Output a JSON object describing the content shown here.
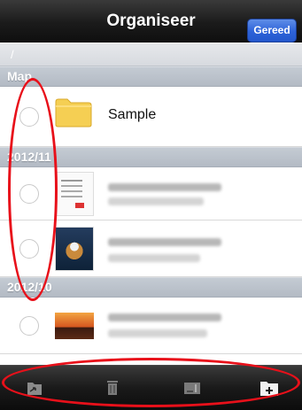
{
  "navbar": {
    "title": "Organiseer",
    "done_label": "Gereed"
  },
  "path": {
    "text": "/"
  },
  "sections": [
    {
      "title": "Map",
      "rows": [
        {
          "type": "folder",
          "icon": "folder-icon",
          "label": "Sample"
        }
      ]
    },
    {
      "title": "2012/11",
      "rows": [
        {
          "type": "file",
          "icon": "document-thumbnail"
        },
        {
          "type": "file",
          "icon": "tiger-photo-thumbnail"
        }
      ]
    },
    {
      "title": "2012/10",
      "rows": [
        {
          "type": "file",
          "icon": "sunset-photo-thumbnail"
        }
      ]
    }
  ],
  "toolbar": {
    "buttons": [
      {
        "name": "move-icon"
      },
      {
        "name": "trash-icon"
      },
      {
        "name": "rename-icon"
      },
      {
        "name": "new-folder-icon"
      }
    ]
  },
  "colors": {
    "navbar": "#1b1b1b",
    "done_button": "#2d62d8",
    "section_header": "#b8bfc8",
    "annotation": "#e8101a"
  }
}
